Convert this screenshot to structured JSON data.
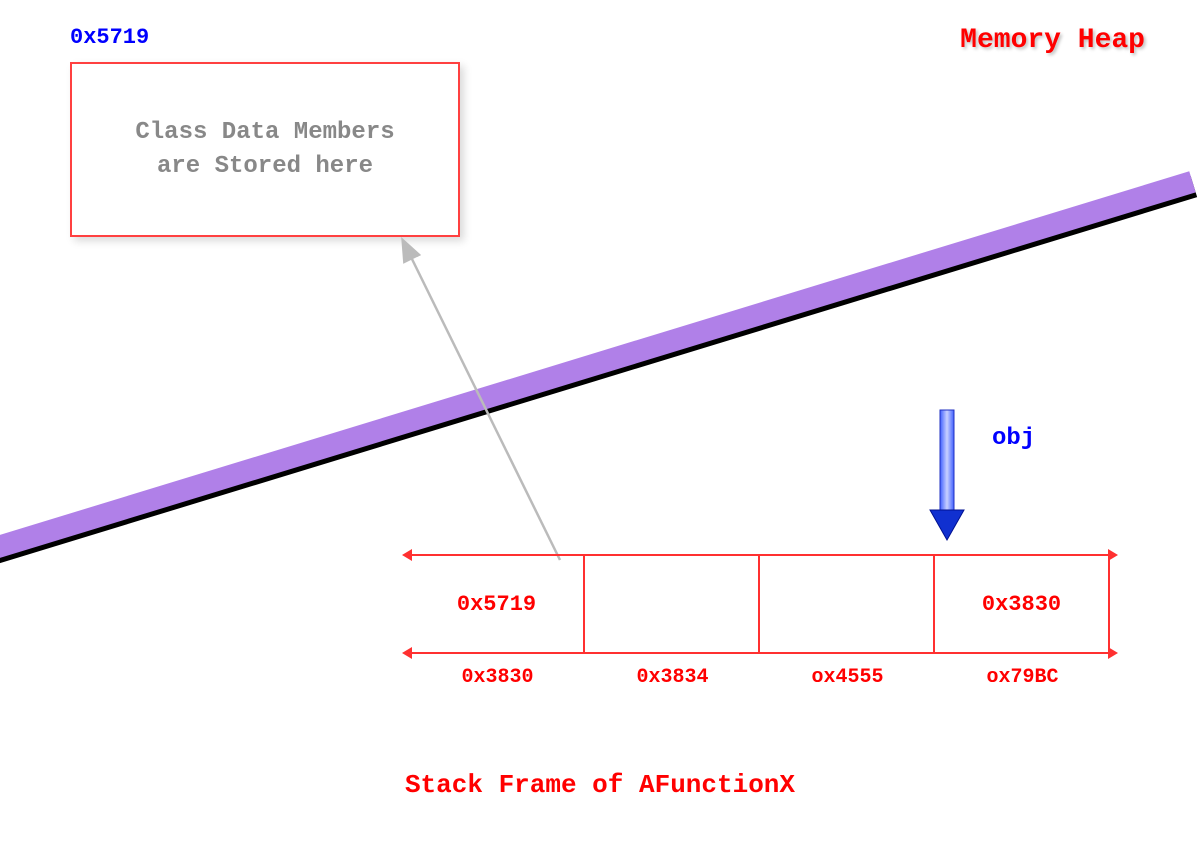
{
  "heap": {
    "address": "0x5719",
    "title": "Memory Heap",
    "box_line1": "Class Data Members",
    "box_line2": "are Stored here"
  },
  "obj_label": "obj",
  "stack": {
    "title": "Stack Frame of AFunctionX",
    "cells": [
      {
        "value": "0x5719",
        "addr": "0x3830"
      },
      {
        "value": "",
        "addr": "0x3834"
      },
      {
        "value": "",
        "addr": "ox4555"
      },
      {
        "value": "0x3830",
        "addr": "ox79BC"
      }
    ]
  }
}
